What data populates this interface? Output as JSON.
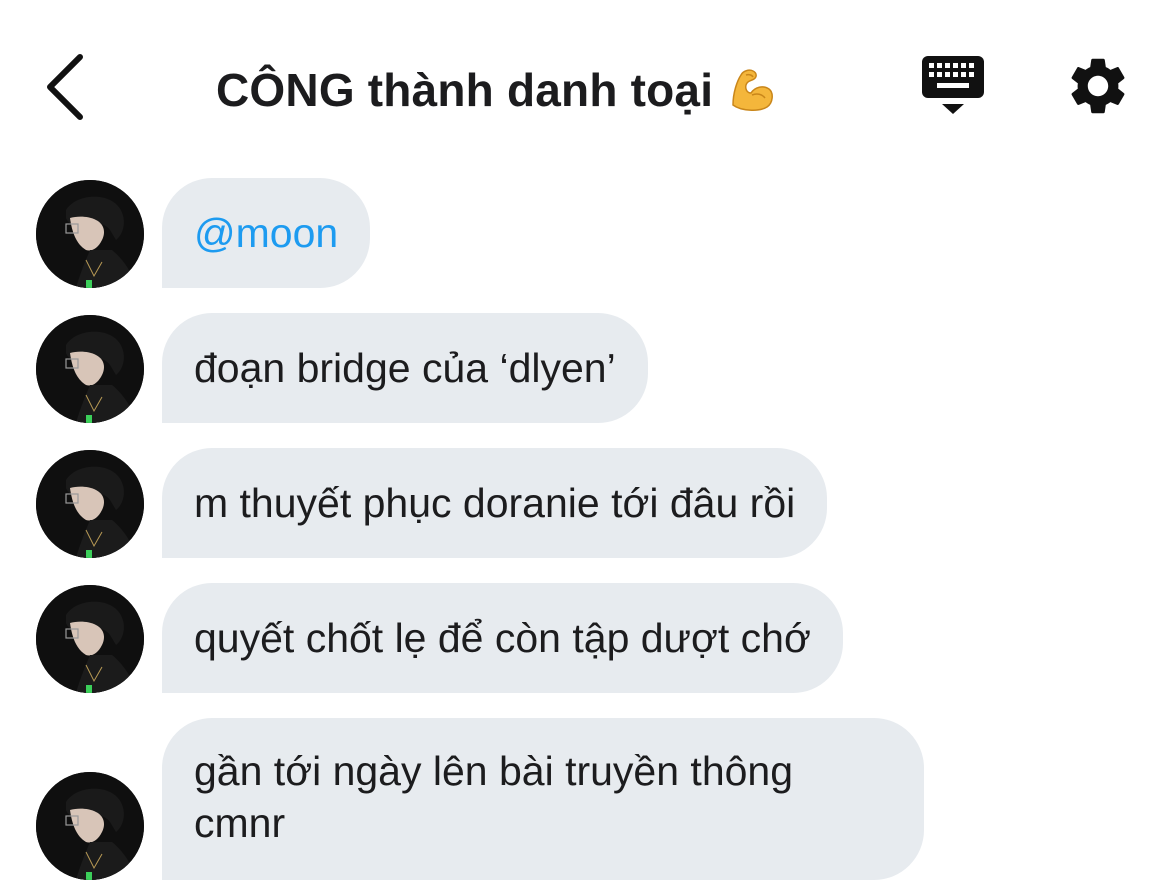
{
  "header": {
    "title": "CÔNG thành danh toại",
    "title_emoji": "flexed-biceps",
    "back_icon": "chevron-left-icon",
    "keyboard_icon": "keyboard-icon",
    "settings_icon": "gear-icon"
  },
  "messages": [
    {
      "text": "@moon"
    },
    {
      "text": "đoạn bridge của ‘dlyen’"
    },
    {
      "text": "m thuyết phục doranie tới đâu rồi"
    },
    {
      "text": "quyết chốt lẹ để còn tập dượt chớ"
    },
    {
      "line1": "gần tới ngày lên bài truyền thông",
      "line2": "cmnr"
    }
  ],
  "colors": {
    "bubble": "#e7ebef",
    "mention": "#1d9bf0",
    "text": "#1c1c1e"
  }
}
